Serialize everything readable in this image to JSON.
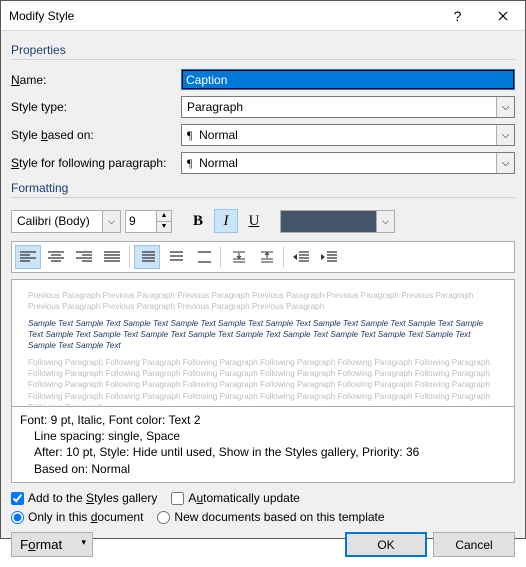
{
  "window": {
    "title": "Modify Style"
  },
  "sections": {
    "properties": "Properties",
    "formatting": "Formatting"
  },
  "fields": {
    "name_label": "Name:",
    "name_accel": "N",
    "name_value": "Caption",
    "type_label": "Style type:",
    "type_value": "Paragraph",
    "based_label": "Style based on:",
    "based_accel": "b",
    "based_value": "Normal",
    "following_label": "Style for following paragraph:",
    "following_accel": "S",
    "following_value": "Normal"
  },
  "font": {
    "family": "Calibri (Body)",
    "size": "9",
    "bold_label": "B",
    "italic_label": "I",
    "underline_label": "U",
    "color": "#44546A"
  },
  "preview": {
    "ghost_previous": "Previous Paragraph Previous Paragraph Previous Paragraph Previous Paragraph Previous Paragraph Previous Paragraph Previous Paragraph Previous Paragraph Previous Paragraph Previous Paragraph",
    "sample": "Sample Text Sample Text Sample Text Sample Text Sample Text Sample Text Sample Text Sample Text Sample Text Sample Text Sample Text Sample Text Sample Text Sample Text Sample Text Sample Text Sample Text Sample Text Sample Text Sample Text Sample Text",
    "ghost_following": "Following Paragraph Following Paragraph Following Paragraph Following Paragraph Following Paragraph Following Paragraph Following Paragraph Following Paragraph Following Paragraph Following Paragraph Following Paragraph Following Paragraph Following Paragraph Following Paragraph Following Paragraph Following Paragraph Following Paragraph Following Paragraph Following Paragraph Following Paragraph Following Paragraph Following Paragraph Following Paragraph Following Paragraph Following Paragraph"
  },
  "description": {
    "l1": "Font: 9 pt, Italic, Font color: Text 2",
    "l2": "Line spacing:  single, Space",
    "l3": "After:  10 pt, Style: Hide until used, Show in the Styles gallery, Priority: 36",
    "l4": "Based on: Normal"
  },
  "options": {
    "add_gallery": "Add to the Styles gallery",
    "add_accel": "S",
    "auto_update": "Automatically update",
    "auto_accel": "u",
    "only_doc": "Only in this document",
    "only_accel": "d",
    "new_template": "New documents based on this template"
  },
  "buttons": {
    "format": "Format",
    "format_accel": "o",
    "ok": "OK",
    "cancel": "Cancel"
  },
  "chart_data": null
}
